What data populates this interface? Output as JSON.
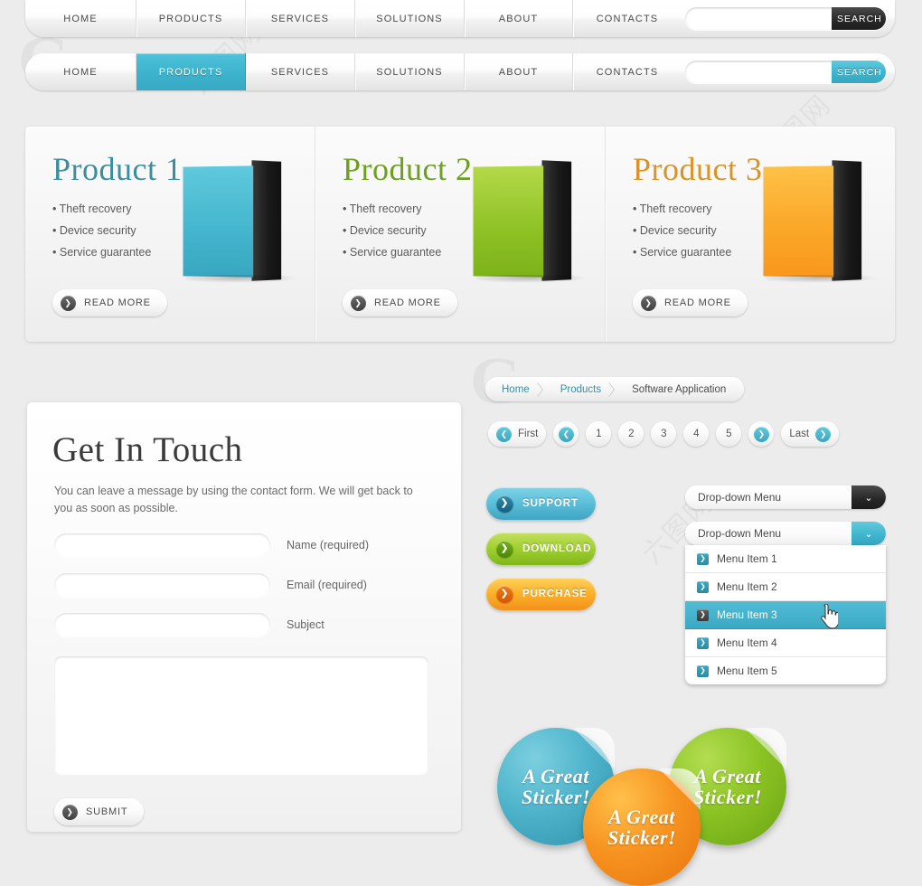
{
  "nav": {
    "top": {
      "items": [
        "HOME",
        "PRODUCTS",
        "SERVICES",
        "SOLUTIONS",
        "ABOUT",
        "CONTACTS"
      ],
      "active_index": -1,
      "search_value": "",
      "search_placeholder": "",
      "search_button": "SEARCH",
      "search_button_color": "#262626"
    },
    "bottom": {
      "items": [
        "HOME",
        "PRODUCTS",
        "SERVICES",
        "SOLUTIONS",
        "ABOUT",
        "CONTACTS"
      ],
      "active_index": 1,
      "search_value": "",
      "search_placeholder": "",
      "search_button": "SEARCH",
      "search_button_color": "#3eb4ce"
    }
  },
  "products": [
    {
      "title": "Product 1",
      "title_color": "#3a8e9e",
      "box_color": "#45b7cf",
      "features": [
        "Theft recovery",
        "Device security",
        "Service guarantee"
      ],
      "read_more": "READ MORE"
    },
    {
      "title": "Product 2",
      "title_color": "#6f9f1f",
      "box_color": "#8fc326",
      "features": [
        "Theft recovery",
        "Device security",
        "Service guarantee"
      ],
      "read_more": "READ MORE"
    },
    {
      "title": "Product 3",
      "title_color": "#d99326",
      "box_color": "#fba828",
      "features": [
        "Theft recovery",
        "Device security",
        "Service guarantee"
      ],
      "read_more": "READ MORE"
    }
  ],
  "contact": {
    "heading": "Get In Touch",
    "intro": "You can leave a message by using the contact form. We will get back to you as soon as possible.",
    "fields": [
      {
        "label": "Name (required)",
        "value": "",
        "placeholder": ""
      },
      {
        "label": "Email (required)",
        "value": "",
        "placeholder": ""
      },
      {
        "label": "Subject",
        "value": "",
        "placeholder": ""
      }
    ],
    "message": {
      "value": "",
      "placeholder": ""
    },
    "submit_label": "SUBMIT"
  },
  "breadcrumb": {
    "items": [
      "Home",
      "Products",
      "Software Application"
    ],
    "link_color": "#3a8e9e",
    "current_color": "#4b4b4b"
  },
  "pagination": {
    "first_label": "First",
    "last_label": "Last",
    "pages": [
      "1",
      "2",
      "3",
      "4",
      "5"
    ],
    "accent_color": "#3ba6bf"
  },
  "action_buttons": [
    {
      "label": "SUPPORT",
      "color": "#5ec0da"
    },
    {
      "label": "DOWNLOAD",
      "color": "#a3d134"
    },
    {
      "label": "PURCHASE",
      "color": "#fbb32c"
    }
  ],
  "dropdowns": {
    "closed": {
      "label": "Drop-down Menu",
      "caret_color": "#262626"
    },
    "open": {
      "label": "Drop-down Menu",
      "caret_color": "#3eb4ce"
    },
    "items": [
      "Menu Item 1",
      "Menu Item 2",
      "Menu Item 3",
      "Menu Item 4",
      "Menu Item 5"
    ],
    "hovered_index": 2,
    "highlight_color": "#3ba9c4"
  },
  "stickers": [
    {
      "line1": "A Great",
      "line2": "Sticker!",
      "color": "#4fb4cb"
    },
    {
      "line1": "A Great",
      "line2": "Sticker!",
      "color": "#f79421"
    },
    {
      "line1": "A Great",
      "line2": "Sticker!",
      "color": "#8cc425"
    }
  ],
  "icons": {
    "chevron_right": "❯",
    "chevron_left": "❮",
    "chevron_down": "⌄"
  }
}
